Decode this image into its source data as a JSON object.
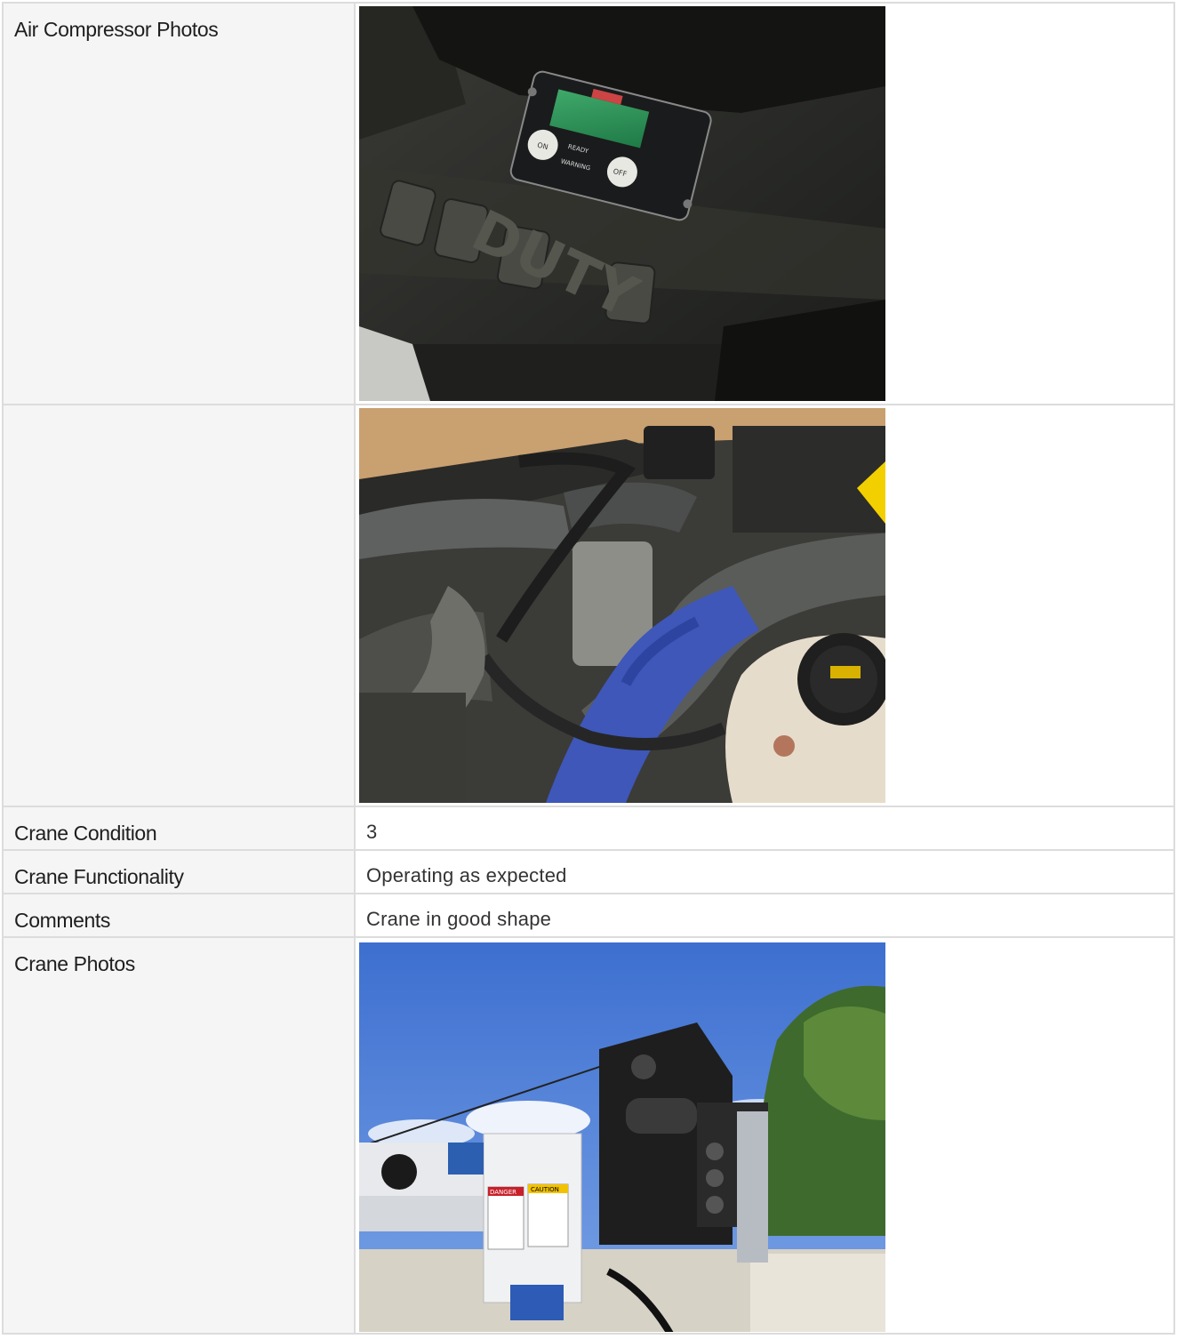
{
  "rows": [
    {
      "label": "Air Compressor Photos",
      "photo": "air-compressor-controller-photo"
    },
    {
      "label": "",
      "photo": "engine-bay-photo"
    },
    {
      "label": "Crane Condition",
      "value": "3"
    },
    {
      "label": "Crane Functionality",
      "value": "Operating as expected"
    },
    {
      "label": "Comments",
      "value": "Crane in good shape"
    },
    {
      "label": "Crane Photos",
      "photo": "crane-photo"
    }
  ],
  "photo_text": {
    "controller_ready": "READY",
    "controller_warning": "WARNING",
    "controller_on": "ON",
    "controller_off": "OFF",
    "floor_mat": "DUTY",
    "crane_danger": "DANGER",
    "crane_caution": "CAUTION"
  }
}
